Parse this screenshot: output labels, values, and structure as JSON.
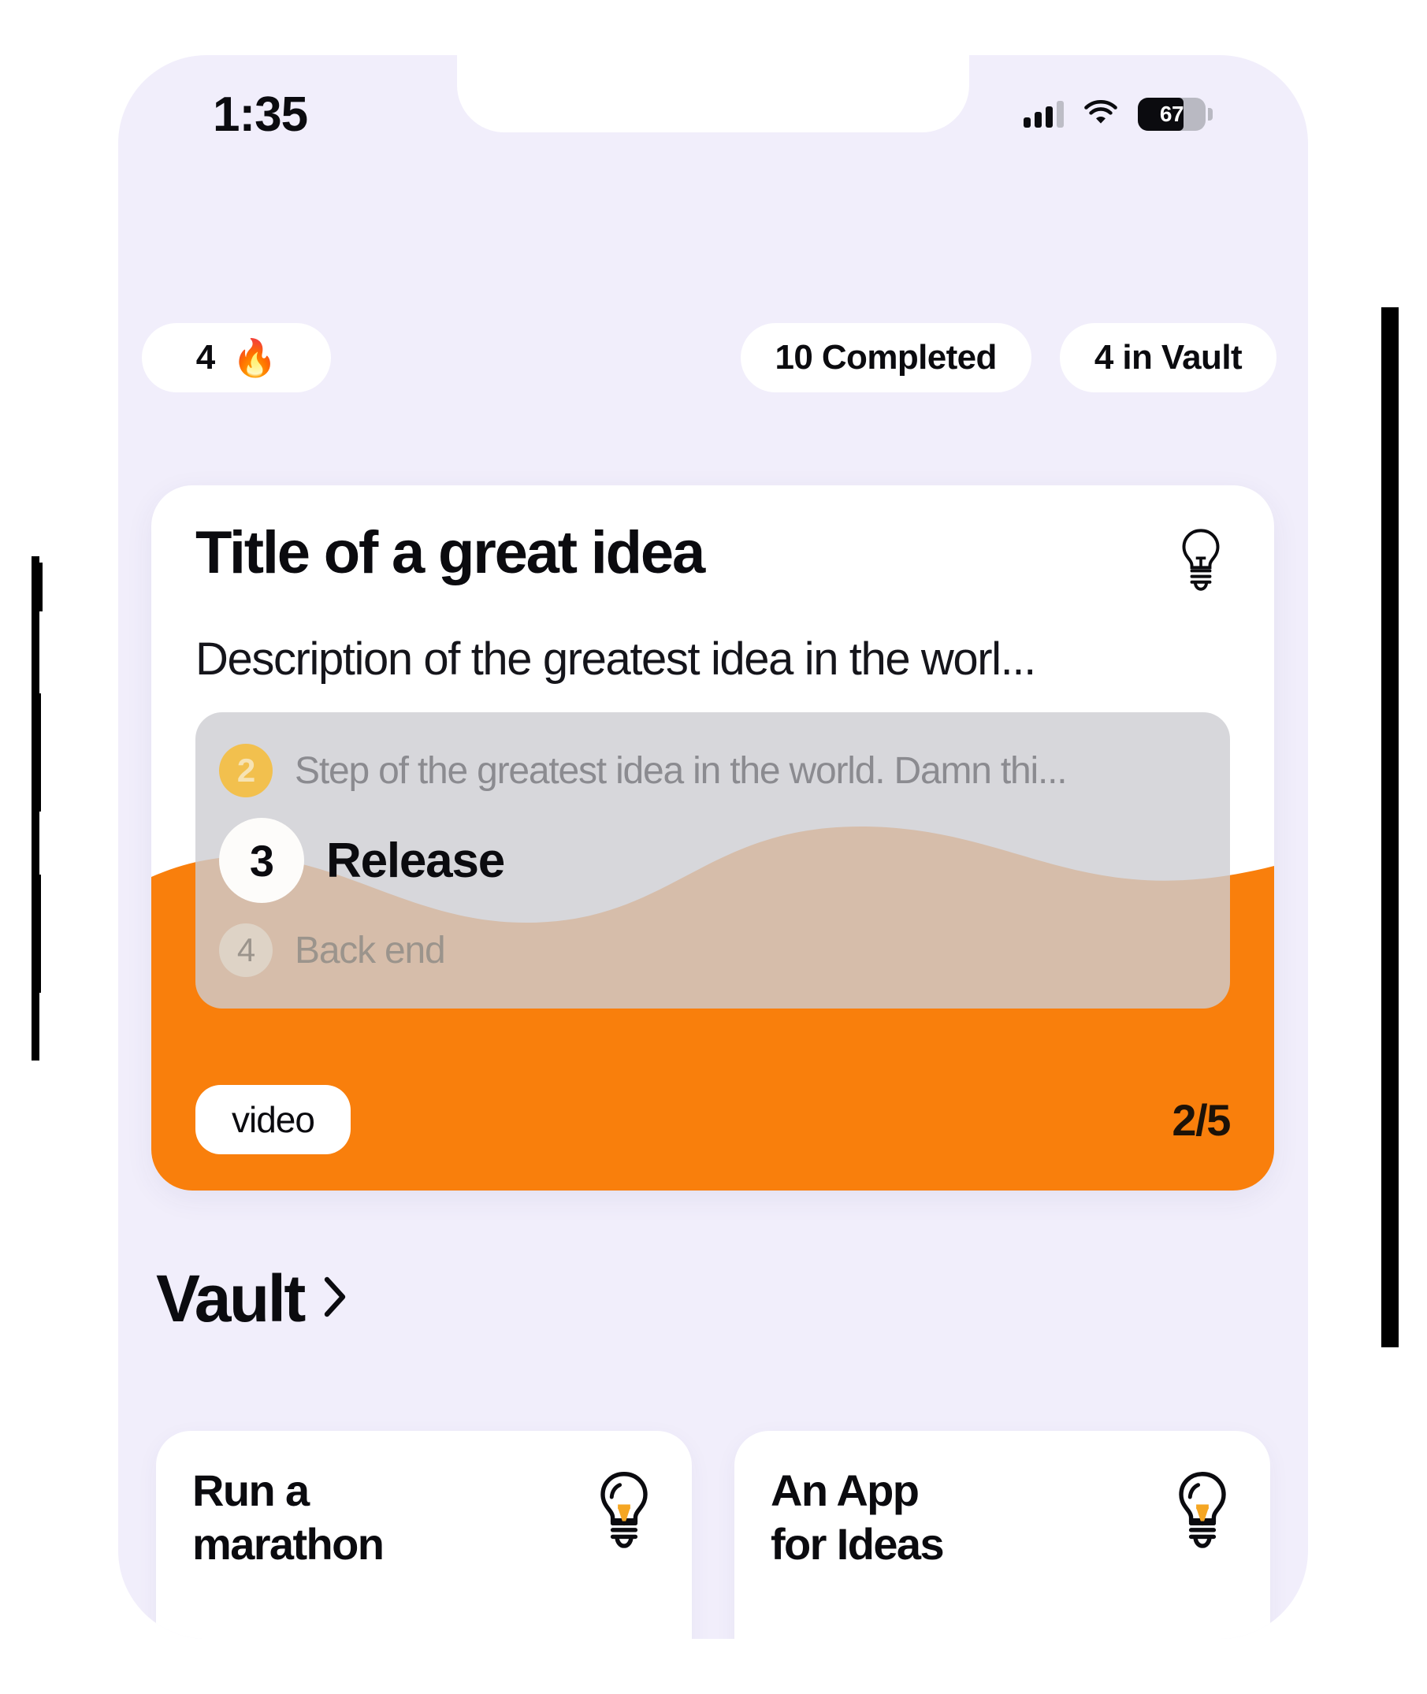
{
  "status_bar": {
    "time": "1:35",
    "battery_percent": "67",
    "battery_level": 67,
    "signal_bars_total": 4,
    "signal_bars_filled": 3,
    "wifi_icon": "wifi-icon",
    "signal_icon": "cellular-signal-icon",
    "battery_icon": "battery-icon"
  },
  "pills": {
    "streak_count": "4",
    "streak_emoji": "🔥",
    "completed_label": "10 Completed",
    "vault_label": "4 in Vault"
  },
  "idea_card": {
    "title": "Title of a great idea",
    "description": "Description of the greatest idea in the worl...",
    "bulb_icon": "lightbulb-icon",
    "steps": [
      {
        "num": "2",
        "text": "Step of the greatest idea in the world. Damn thi...",
        "state": "done"
      },
      {
        "num": "3",
        "text": "Release",
        "state": "active"
      },
      {
        "num": "4",
        "text": "Back end",
        "state": "todo"
      }
    ],
    "tag": "video",
    "counter": "2/5"
  },
  "vault": {
    "heading": "Vault",
    "chevron_icon": "chevron-right-icon",
    "cards": [
      {
        "title": "Run a\nmarathon",
        "bulb_icon": "lightbulb-icon"
      },
      {
        "title": "An App\nfor Ideas",
        "bulb_icon": "lightbulb-icon"
      }
    ]
  },
  "colors": {
    "accent_orange": "#F97F0C",
    "fill_tint": "#E0D5C8",
    "background": "#F1EEFB",
    "panel_grey": "#DDDDDD",
    "badge_yellow": "#F2C04E",
    "card_white": "#FFFFFF",
    "text_primary": "#0B0B0F",
    "text_muted": "#8B8B90"
  }
}
